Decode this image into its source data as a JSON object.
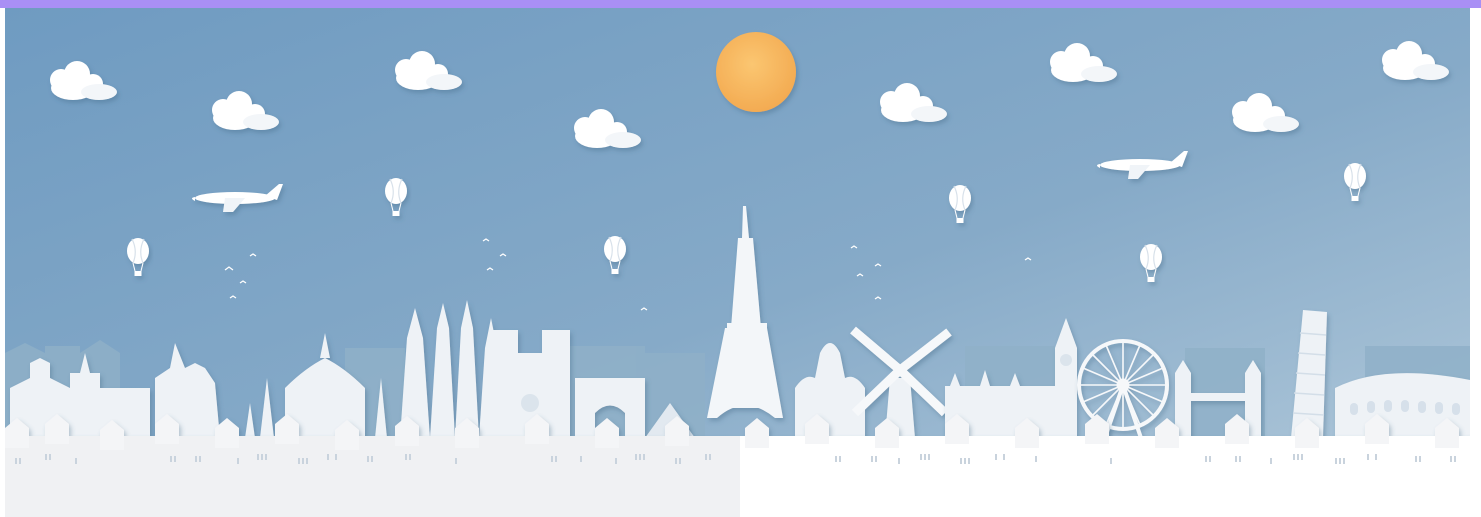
{
  "scene": {
    "description_label": "",
    "colors": {
      "top_bar": "#a98ff5",
      "sky_top": "#6f9bc1",
      "sky_bottom": "#a9c3d8",
      "sun": "#f7b55a",
      "cloud": "#ffffff",
      "far_buildings": "#8fb0c8",
      "landmarks": "#f1f4f7",
      "foreground_left": "#f0f1f3",
      "foreground_right": "#ffffff"
    },
    "icons": [
      "sun-icon",
      "cloud-icon",
      "airplane-icon",
      "hot-air-balloon-icon",
      "bird-icon",
      "eiffel-tower-icon",
      "windmill-icon",
      "ferris-wheel-icon",
      "leaning-tower-icon",
      "colosseum-icon",
      "cathedral-icon",
      "arc-icon",
      "big-ben-icon"
    ]
  }
}
